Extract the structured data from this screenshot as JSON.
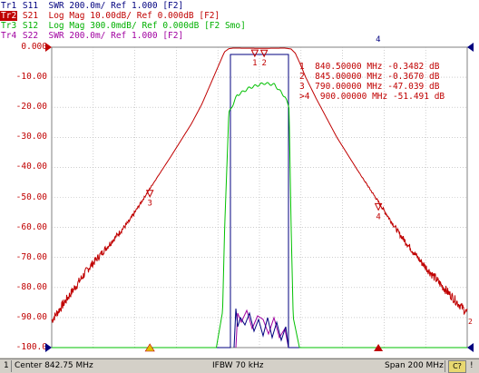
{
  "traces": [
    {
      "id": "Tr1",
      "desc": " S11  SWR 200.0m/ Ref 1.000 [F2]"
    },
    {
      "id": "Tr2",
      "desc": " S21  Log Mag 10.00dB/ Ref 0.000dB [F2]"
    },
    {
      "id": "Tr3",
      "desc": " S12  Log Mag 300.0mdB/ Ref 0.000dB [F2 Smo]"
    },
    {
      "id": "Tr4",
      "desc": " S22  SWR 200.0m/ Ref 1.000 [F2]"
    }
  ],
  "y_ticks": [
    "0.000",
    "-10.00",
    "-20.00",
    "-30.00",
    "-40.00",
    "-50.00",
    "-60.00",
    "-70.00",
    "-80.00",
    "-90.00",
    "-100.0"
  ],
  "marker_table": [
    "1  840.50000 MHz -0.3482 dB",
    "2  845.00000 MHz -0.3670 dB",
    "3  790.00000 MHz -47.039 dB",
    ">4  900.00000 MHz -51.491 dB"
  ],
  "markers": [
    {
      "label": "1",
      "freq_mhz": 840.5,
      "value_db": -0.3482
    },
    {
      "label": "2",
      "freq_mhz": 845.0,
      "value_db": -0.367
    },
    {
      "label": "3",
      "freq_mhz": 790.0,
      "value_db": -47.039
    },
    {
      "label": "4",
      "freq_mhz": 900.0,
      "value_db": -51.491
    }
  ],
  "edge_labels": [
    "2",
    "4",
    "3",
    "4",
    "1",
    "2",
    "4",
    "2"
  ],
  "colors": {
    "s11": "#00007f",
    "s21": "#c00000",
    "s12": "#00c000",
    "s22": "#a000a0",
    "grid": "#b0b0b0"
  },
  "chart_data": {
    "type": "line",
    "xlim": [
      742.75,
      942.75
    ],
    "ylim": [
      -100,
      0
    ],
    "x_unit": "MHz",
    "y_unit": "dB",
    "s21_series": {
      "x": [
        742.75,
        760,
        780,
        790,
        800,
        810,
        815,
        820,
        825,
        826,
        828,
        830,
        840.5,
        845,
        855,
        858,
        860,
        862,
        865,
        870,
        880,
        890,
        900,
        910,
        920,
        930,
        942.75
      ],
      "y": [
        -91,
        -74,
        -58,
        -47.039,
        -36.5,
        -25.5,
        -19,
        -11,
        -3,
        -1.5,
        -0.5,
        -0.3,
        -0.3482,
        -0.367,
        -0.3,
        -0.6,
        -2,
        -5,
        -10,
        -17,
        -30,
        -41,
        -51.491,
        -62,
        -71,
        -79,
        -88.5
      ]
    },
    "s12_series": {
      "x": [
        742.75,
        822,
        825,
        826,
        828,
        832,
        838,
        845,
        850,
        855,
        857,
        858,
        859,
        862,
        942.75
      ],
      "y": [
        -100,
        -100,
        -88,
        -60,
        -22,
        -16,
        -13.5,
        -12,
        -12.5,
        -16.5,
        -20,
        -60,
        -90,
        -100,
        -100
      ]
    }
  },
  "status": {
    "channel": "1",
    "center": "Center 842.75 MHz",
    "ifbw": "IFBW 70 kHz",
    "span": "Span 200 MHz",
    "cal": "C?",
    "warn": "!"
  }
}
